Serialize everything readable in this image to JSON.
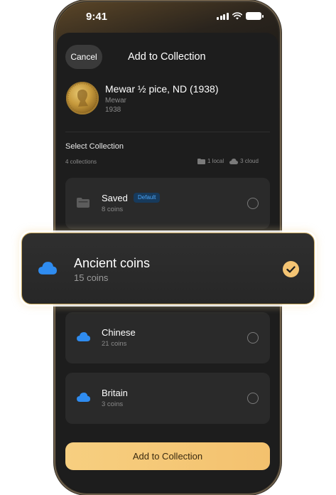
{
  "status_bar": {
    "time": "9:41"
  },
  "header": {
    "cancel_label": "Cancel",
    "title": "Add to Collection"
  },
  "item": {
    "title": "Mewar ½ pice, ND (1938)",
    "region": "Mewar",
    "year": "1938"
  },
  "select": {
    "title": "Select Collection",
    "count": "4 collections",
    "local": "1 local",
    "cloud": "3 cloud"
  },
  "collections": [
    {
      "name": "Saved",
      "badge": "Default",
      "count": "8 coins",
      "selected": false,
      "storage": "local"
    },
    {
      "name": "Ancient coins",
      "count": "15 coins",
      "selected": true,
      "storage": "cloud"
    },
    {
      "name": "Chinese",
      "count": "21 coins",
      "selected": false,
      "storage": "cloud"
    },
    {
      "name": "Britain",
      "count": "3 coins",
      "selected": false,
      "storage": "cloud"
    }
  ],
  "footer": {
    "add_label": "Add to Collection"
  },
  "colors": {
    "accent": "#f4c473",
    "cloud": "#2f8cf0",
    "background": "#121212"
  }
}
